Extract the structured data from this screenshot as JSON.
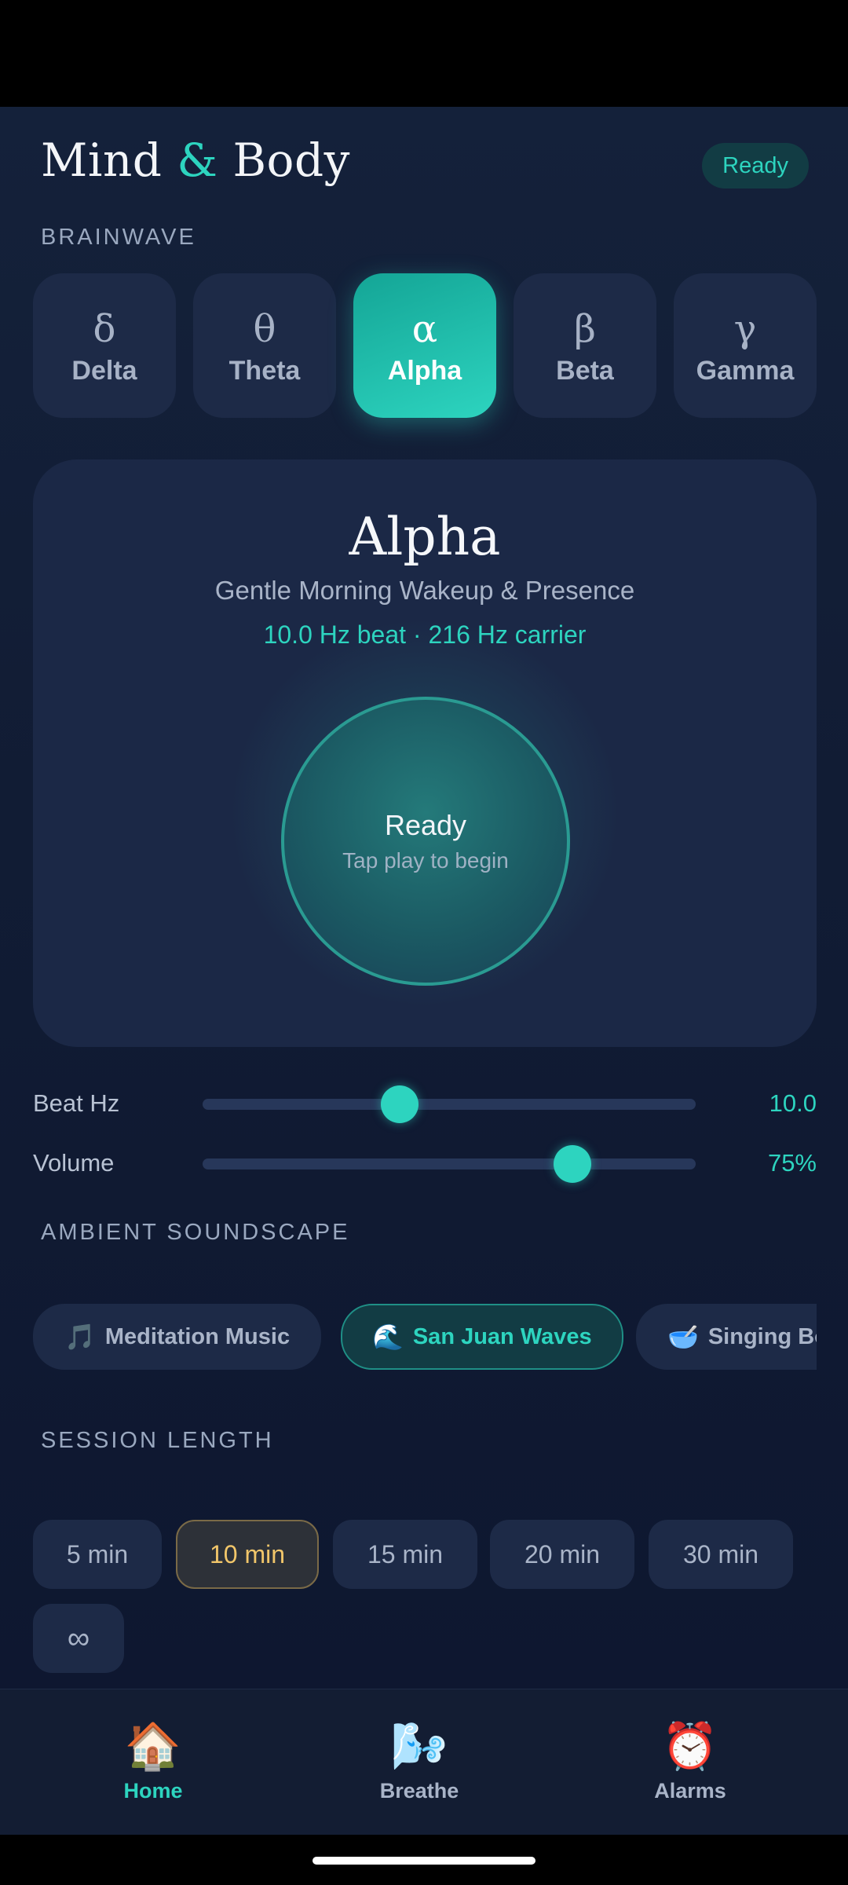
{
  "header": {
    "title_part1": "Mind",
    "title_amp": "&",
    "title_part2": "Body",
    "status": "Ready"
  },
  "brainwave": {
    "label": "BRAINWAVE",
    "options": [
      {
        "symbol": "δ",
        "name": "Delta"
      },
      {
        "symbol": "θ",
        "name": "Theta"
      },
      {
        "symbol": "α",
        "name": "Alpha"
      },
      {
        "symbol": "β",
        "name": "Beta"
      },
      {
        "symbol": "γ",
        "name": "Gamma"
      }
    ],
    "selected": "Alpha"
  },
  "session_card": {
    "title": "Alpha",
    "subtitle": "Gentle Morning Wakeup & Presence",
    "meta": "10.0 Hz beat · 216 Hz carrier",
    "orb_title": "Ready",
    "orb_hint": "Tap play to begin"
  },
  "controls": {
    "beat": {
      "label": "Beat Hz",
      "value_text": "10.0",
      "fraction": 0.4
    },
    "volume": {
      "label": "Volume",
      "value_text": "75%",
      "fraction": 0.75
    }
  },
  "soundscape": {
    "label": "AMBIENT SOUNDSCAPE",
    "chips": [
      {
        "emoji": "🎵",
        "label": "Meditation Music"
      },
      {
        "emoji": "🌊",
        "label": "San Juan Waves"
      },
      {
        "emoji": "🥣",
        "label": "Singing Bowls"
      }
    ],
    "selected": "San Juan Waves"
  },
  "session_length": {
    "label": "SESSION LENGTH",
    "options": [
      "5 min",
      "10 min",
      "15 min",
      "20 min",
      "30 min",
      "∞"
    ],
    "selected": "10 min"
  },
  "bottom_nav": [
    {
      "icon": "house-icon",
      "glyph": "🏠",
      "label": "Home"
    },
    {
      "icon": "breathe-icon",
      "glyph": "🌬️",
      "label": "Breathe"
    },
    {
      "icon": "alarm-clock-icon",
      "glyph": "⏰",
      "label": "Alarms"
    }
  ],
  "colors": {
    "accent": "#2dd4bf",
    "background": "#0d1528",
    "card": "#1b2846",
    "selected_length": "#f1c66a"
  }
}
